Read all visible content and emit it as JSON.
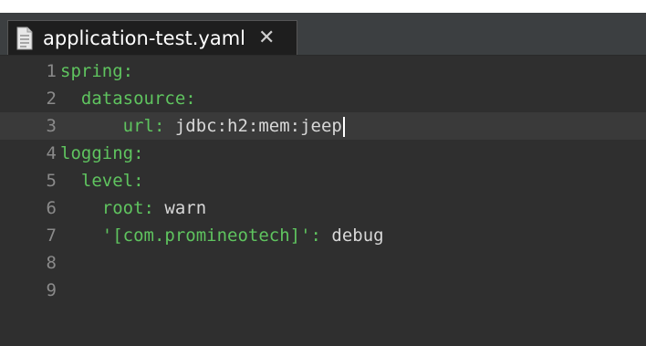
{
  "tab": {
    "title": "application-test.yaml",
    "close_label": "✕",
    "icon": "document-icon"
  },
  "editor": {
    "current_line": 3,
    "lines": [
      {
        "num": "1",
        "indent": "",
        "key": "spring:",
        "value": ""
      },
      {
        "num": "2",
        "indent": "  ",
        "key": "datasource:",
        "value": ""
      },
      {
        "num": "3",
        "indent": "      ",
        "key": "url:",
        "value": " jdbc:h2:mem:jeep"
      },
      {
        "num": "4",
        "indent": "",
        "key": "logging:",
        "value": ""
      },
      {
        "num": "5",
        "indent": "  ",
        "key": "level:",
        "value": ""
      },
      {
        "num": "6",
        "indent": "    ",
        "key": "root:",
        "value": " warn"
      },
      {
        "num": "7",
        "indent": "    ",
        "key": "'[com.promineotech]':",
        "value": " debug"
      },
      {
        "num": "8",
        "indent": "",
        "key": "",
        "value": ""
      },
      {
        "num": "9",
        "indent": "",
        "key": "",
        "value": ""
      }
    ]
  },
  "colors": {
    "key": "#5fc45f",
    "value": "#d8d8d8",
    "line_number": "#8a8a8a",
    "background": "#2f2f2f"
  }
}
